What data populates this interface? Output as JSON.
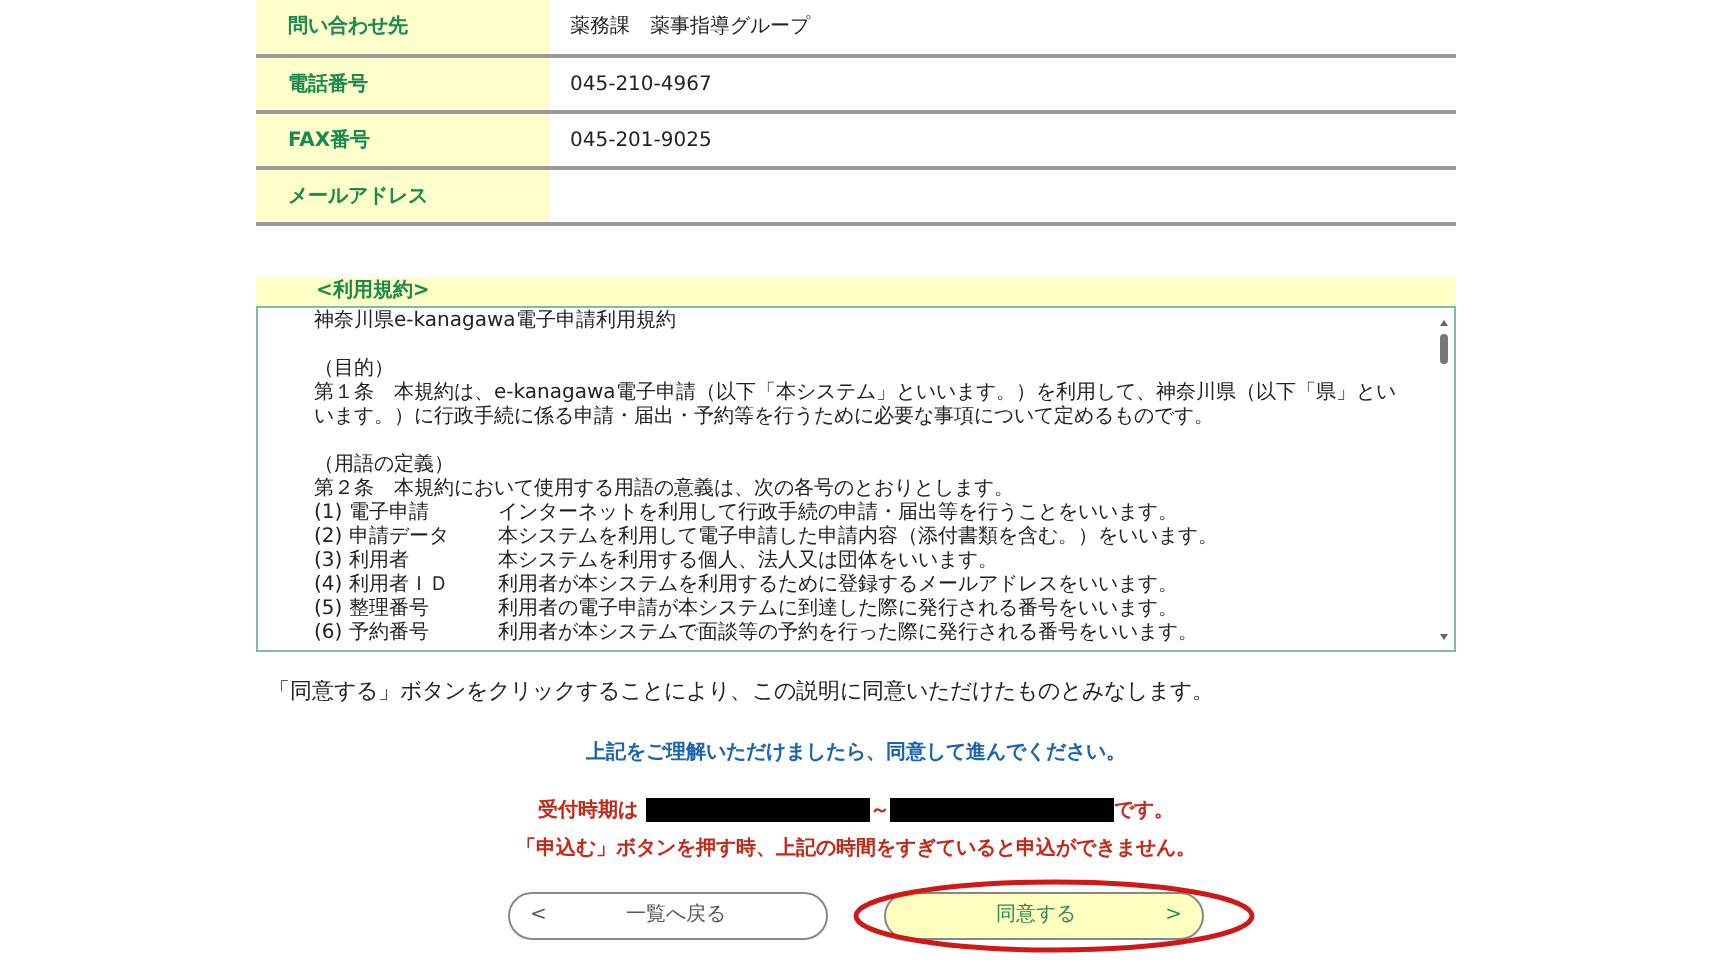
{
  "contact_table": {
    "rows": [
      {
        "label": "問い合わせ先",
        "value": "薬務課　薬事指導グループ"
      },
      {
        "label": "電話番号",
        "value": "045-210-4967"
      },
      {
        "label": "FAX番号",
        "value": "045-201-9025"
      },
      {
        "label": "メールアドレス",
        "value": ""
      }
    ]
  },
  "terms": {
    "heading": "<利用規約>",
    "blocks": [
      [
        {
          "kind": "text",
          "text": "神奈川県e-kanagawa電子申請利用規約"
        }
      ],
      [
        {
          "kind": "text",
          "text": "（目的）"
        },
        {
          "kind": "text",
          "text": "第１条　本規約は、e-kanagawa電子申請（以下「本システム」といいます。）を利用して、神奈川県（以下「県」といいます。）に行政手続に係る申請・届出・予約等を行うために必要な事項について定めるものです。"
        }
      ],
      [
        {
          "kind": "text",
          "text": "（用語の定義）"
        },
        {
          "kind": "text",
          "text": "第２条　本規約において使用する用語の意義は、次の各号のとおりとします。"
        },
        {
          "kind": "definition",
          "term": "(1) 電子申請",
          "description": "インターネットを利用して行政手続の申請・届出等を行うことをいいます。"
        },
        {
          "kind": "definition",
          "term": "(2) 申請データ",
          "description": "本システムを利用して電子申請した申請内容（添付書類を含む。）をいいます。"
        },
        {
          "kind": "definition",
          "term": "(3) 利用者",
          "description": "本システムを利用する個人、法人又は団体をいいます。"
        },
        {
          "kind": "definition",
          "term": "(4) 利用者ＩＤ",
          "description": "利用者が本システムを利用するために登録するメールアドレスをいいます。"
        },
        {
          "kind": "definition",
          "term": "(5) 整理番号",
          "description": "利用者の電子申請が本システムに到達した際に発行される番号をいいます。"
        },
        {
          "kind": "definition",
          "term": "(6) 予約番号",
          "description": "利用者が本システムで面談等の予約を行った際に発行される番号をいいます。"
        }
      ]
    ]
  },
  "consent_note": "「同意する」ボタンをクリックすることにより、この説明に同意いただけたものとみなします。",
  "instruction": "上記をご理解いただけましたら、同意して進んでください。",
  "period": {
    "prefix": "受付時期は",
    "separator": "～",
    "suffix": "です。"
  },
  "warning": "「申込む」ボタンを押す時、上記の時間をすぎていると申込ができません。",
  "buttons": [
    {
      "kind": "back",
      "icon": "<",
      "label": "一覧へ戻る",
      "highlighted": false
    },
    {
      "kind": "agree",
      "icon": ">",
      "label": "同意する",
      "highlighted": true
    }
  ]
}
